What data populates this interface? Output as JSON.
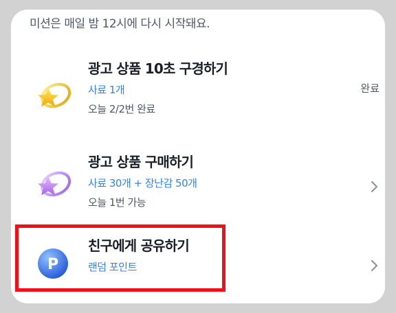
{
  "notice": "미션은 매일 밤 12시에 다시 시작돼요.",
  "missions": [
    {
      "title": "광고 상품 10초 구경하기",
      "reward": "사료 1개",
      "sub": "오늘 2/2번 완료",
      "status": "완료",
      "icon": "star-ring-icon",
      "icon_color": "#f5c518"
    },
    {
      "title": "광고 상품 구매하기",
      "reward": "사료 30개 + 장난감 50개",
      "sub": "오늘 1번 가능",
      "icon": "star-ring-icon",
      "icon_color": "#b07bea"
    },
    {
      "title": "친구에게 공유하기",
      "reward": "랜덤 포인트",
      "icon": "point-coin-icon",
      "icon_label": "P",
      "icon_color": "#2f6fe0"
    }
  ],
  "colors": {
    "accent": "#3182f6",
    "highlight": "#f0101a"
  }
}
